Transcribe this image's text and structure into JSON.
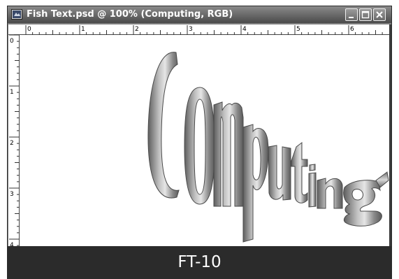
{
  "window": {
    "title": "Fish Text.psd @ 100% (Computing, RGB)",
    "buttons": {
      "minimize": "minimize-icon",
      "maximize": "maximize-icon",
      "close": "close-icon"
    }
  },
  "rulers": {
    "top_labels": [
      "0",
      "1",
      "2",
      "3",
      "4",
      "5",
      "6"
    ],
    "left_labels": [
      "0",
      "1",
      "2",
      "3",
      "4"
    ]
  },
  "canvas": {
    "warped_text": "Computing",
    "warp_style": "fish",
    "fill": "metallic grey gradient"
  },
  "caption": "FT-10",
  "colors": {
    "title_bar": "#5a5a5a",
    "caption_bar": "#2b2b2b",
    "text_light": "#c0c0c0",
    "text_dark": "#5e5e5e"
  }
}
